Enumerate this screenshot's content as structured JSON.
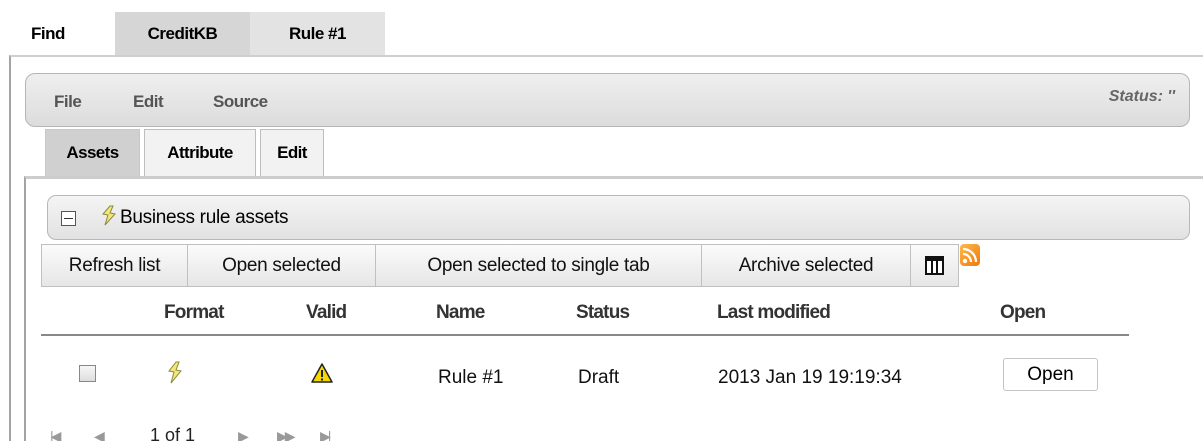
{
  "top_tabs": [
    {
      "label": "Find",
      "active": false
    },
    {
      "label": "CreditKB",
      "active": true
    },
    {
      "label": "Rule #1",
      "active": false
    }
  ],
  "menubar": {
    "items": [
      "File",
      "Edit",
      "Source"
    ],
    "status": "Status: ''"
  },
  "inner_tabs": [
    {
      "label": "Assets",
      "active": true
    },
    {
      "label": "Attribute",
      "active": false
    },
    {
      "label": "Edit",
      "active": false
    }
  ],
  "section": {
    "title": "Business rule assets",
    "icon": "rule-icon",
    "collapse_icon": "collapse-minus-icon"
  },
  "toolbar": {
    "refresh": "Refresh list",
    "open_selected": "Open selected",
    "open_single_tab": "Open selected to single tab",
    "archive": "Archive selected",
    "columns_icon": "columns-icon",
    "rss_icon": "rss-icon"
  },
  "table": {
    "columns": [
      "Format",
      "Valid",
      "Name",
      "Status",
      "Last modified",
      "Open"
    ],
    "rows": [
      {
        "checked": false,
        "format_icon": "rule-icon",
        "valid_icon": "warning-icon",
        "name": "Rule #1",
        "status": "Draft",
        "last_modified": "2013 Jan 19 19:19:34",
        "open_label": "Open"
      }
    ]
  },
  "pager": {
    "text": "1 of 1",
    "icons": [
      "first-page-icon",
      "prev-page-icon",
      "next-page-icon",
      "fast-forward-icon",
      "last-page-icon"
    ]
  },
  "colors": {
    "active_tab": "#d6d6d6",
    "panel_border": "#a3a3a3",
    "rss": "#f07a08",
    "warning": "#f5d800"
  }
}
